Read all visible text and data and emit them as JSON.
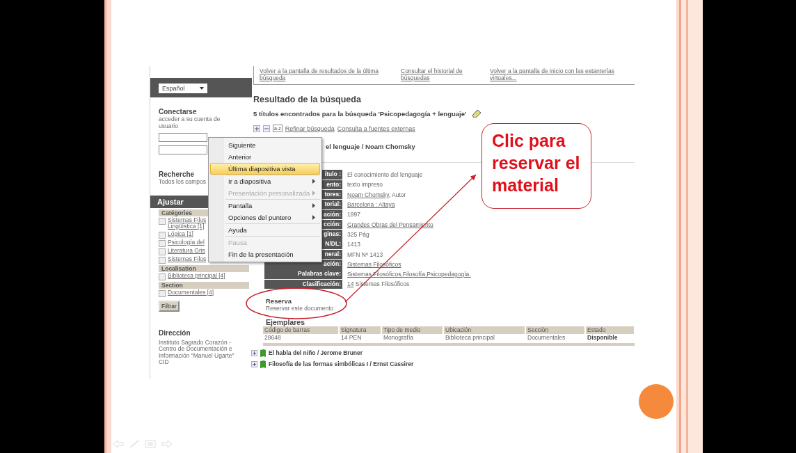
{
  "sidebar": {
    "language": "Español",
    "login": {
      "title": "Conectarse",
      "description": "acceder a su cuenta de usuario"
    },
    "search": {
      "title": "Recherche",
      "scope": "Todos los campos"
    },
    "refine": {
      "title": "Ajustar",
      "facets": [
        {
          "heading": "Catégories",
          "items": [
            {
              "label": "Sistemas Filos",
              "continued": "Lingüística [1]",
              "checked": false
            },
            {
              "label": "Lógica [1]",
              "checked": false
            },
            {
              "label": "Psicología del",
              "checked": false
            },
            {
              "label": "Literatura Gris",
              "checked": false
            },
            {
              "label": "Sistemas Filos",
              "checked": false
            }
          ]
        },
        {
          "heading": "Localisation",
          "items": [
            {
              "label": "Biblioteca principal [4]",
              "checked": false
            }
          ]
        },
        {
          "heading": "Section",
          "items": [
            {
              "label": "Documentales [4]",
              "checked": false
            }
          ]
        }
      ],
      "filter_button": "Filtrar"
    },
    "address": {
      "title": "Dirección",
      "lines": [
        "Instituto Sagrado Corazón -",
        "Centro de Documentación e",
        "Información \"Manuel Ugarte\"",
        "CID"
      ]
    }
  },
  "top_links": [
    "Volver a la pantalla de resultados de la última búsqueda",
    "Consultar el historial de búsquedas",
    "Volver a la pantalla de inicio con las estanterías virtuales..."
  ],
  "results": {
    "title": "Resultado de la búsqueda",
    "summary": "5 títulos encontrados para la búsqueda 'Psicopedagogía + lenguaje'",
    "tools": [
      "Refinar búsqueda",
      "Consulta a fuentes externas"
    ],
    "sort_icon": "a-z",
    "record": {
      "title": "el lenguaje / Noam Chomsky",
      "fields": [
        {
          "label": "ítulo :",
          "value": "El conocimiento del lenguaje",
          "link": false
        },
        {
          "label": "ento:",
          "value": "texto impreso",
          "link": false
        },
        {
          "label": "tores:",
          "value": "Noam Chomsky",
          "link": true,
          "suffix": ", Autor"
        },
        {
          "label": "torial:",
          "value": "Barcelona : Altaya",
          "link": true
        },
        {
          "label": "ación:",
          "value": "1997",
          "link": false
        },
        {
          "label": "cción:",
          "value": "Grandes Obras del Pensamiento",
          "link": true
        },
        {
          "label": "ginas:",
          "value": "325 Pág",
          "link": false
        },
        {
          "label": "N/DL:",
          "value": "1413",
          "link": false
        },
        {
          "label": "neral:",
          "value": "MFN Nº 1413",
          "link": false
        },
        {
          "label": "ación:",
          "value": "Sistemas Filosóficos",
          "link": true
        },
        {
          "label": "Palabras clave:",
          "value": "Sistemas Filosóficos,Filosofía,Psicopedagogía.",
          "link": true
        },
        {
          "label": "Clasificación:",
          "value": "14",
          "link": true,
          "suffix": " Sistemas Filosóficos"
        }
      ],
      "reserve": {
        "title": "Reserva",
        "link": "Reservar este documento"
      },
      "copies": {
        "title": "Ejemplares",
        "columns": [
          "Código de barras",
          "Signatura",
          "Tipo de medio",
          "Ubicación",
          "Sección",
          "Estado"
        ],
        "rows": [
          [
            "28648",
            "14 PEN",
            "Monografía",
            "Biblioteca principal",
            "Documentales",
            "Disponible"
          ]
        ]
      }
    },
    "more": [
      {
        "title": "El habla del niño / Jerome Bruner"
      },
      {
        "title": "Filosofía de las formas simbólicas I / Ernst Cassirer"
      }
    ]
  },
  "context_menu": {
    "groups": [
      [
        {
          "label": "Siguiente",
          "selected": false,
          "disabled": false,
          "submenu": false
        },
        {
          "label": "Anterior",
          "selected": false,
          "disabled": false,
          "submenu": false
        },
        {
          "label": "Última diapositiva vista",
          "selected": true,
          "disabled": false,
          "submenu": false
        }
      ],
      [
        {
          "label": "Ir a diapositiva",
          "selected": false,
          "disabled": false,
          "submenu": true
        },
        {
          "label": "Presentación personalizada",
          "selected": false,
          "disabled": true,
          "submenu": true
        }
      ],
      [
        {
          "label": "Pantalla",
          "selected": false,
          "disabled": false,
          "submenu": true
        },
        {
          "label": "Opciones del puntero",
          "selected": false,
          "disabled": false,
          "submenu": true
        }
      ],
      [
        {
          "label": "Ayuda",
          "selected": false,
          "disabled": false,
          "submenu": false
        }
      ],
      [
        {
          "label": "Pausa",
          "selected": false,
          "disabled": true,
          "submenu": false
        },
        {
          "label": "Fin de la presentación",
          "selected": false,
          "disabled": false,
          "submenu": false
        }
      ]
    ]
  },
  "callout": "Clic para reservar el material"
}
